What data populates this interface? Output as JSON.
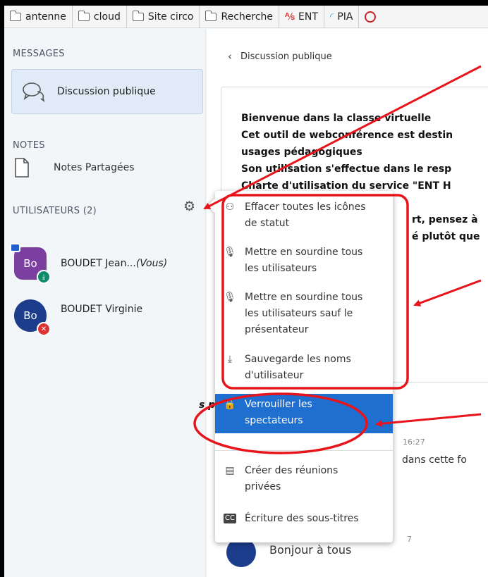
{
  "bookmarks": [
    {
      "label": "antenne",
      "icon": "folder-icon"
    },
    {
      "label": "cloud",
      "icon": "folder-icon"
    },
    {
      "label": "Site circo",
      "icon": "folder-icon"
    },
    {
      "label": "Recherche",
      "icon": "folder-icon"
    },
    {
      "label": "ENT",
      "icon": "ent-logo-icon"
    },
    {
      "label": "PIA",
      "icon": "pia-logo-icon"
    }
  ],
  "sidebar": {
    "messages_header": "MESSAGES",
    "public_chat": "Discussion publique",
    "notes_header": "NOTES",
    "shared_notes": "Notes Partagées",
    "users_header": "UTILISATEURS (2)",
    "users": [
      {
        "initials": "Bo",
        "name": "BOUDET Jean...",
        "suffix": "(Vous)",
        "color": "#7b3fa0"
      },
      {
        "initials": "Bo",
        "name": "BOUDET Virginie",
        "suffix": "",
        "color": "#1c3c8c"
      }
    ]
  },
  "main": {
    "back_label": "Discussion publique",
    "welcome_lines": [
      "Bienvenue dans la classe virtuelle",
      "Cet outil de webconférence est destin",
      "usages pédagogiques",
      "Son utilisation s'effectue dans le resp",
      "Charte d'utilisation du service \"ENT H",
      "rt, pensez à",
      "é plutôt que"
    ],
    "italic_heading": "s publiques o",
    "time1": "16:27",
    "msg_fragment": "dans cette fo",
    "time2": "7",
    "hello": "Bonjour à tous"
  },
  "menu": {
    "items": [
      {
        "label": "Effacer toutes les icônes de statut",
        "icon": "clear-status-icon",
        "lines": [
          "Effacer toutes les icônes",
          "de statut"
        ]
      },
      {
        "label": "Mettre en sourdine tous les utilisateurs",
        "icon": "mute-icon",
        "lines": [
          "Mettre en sourdine tous",
          "les utilisateurs"
        ]
      },
      {
        "label": "Mettre en sourdine tous les utilisateurs sauf le présentateur",
        "icon": "mute-icon",
        "lines": [
          "Mettre en sourdine tous",
          "les utilisateurs sauf le",
          "présentateur"
        ]
      },
      {
        "label": "Sauvegarde les noms d'utilisateur",
        "icon": "download-icon",
        "lines": [
          "Sauvegarde les noms",
          "d'utilisateur"
        ]
      },
      {
        "label": "Verrouiller les spectateurs",
        "icon": "lock-icon",
        "lines": [
          "Verrouiller les",
          "spectateurs"
        ],
        "selected": true
      },
      {
        "label": "Créer des réunions privées",
        "icon": "breakout-rooms-icon",
        "lines": [
          "Créer des réunions",
          "privées"
        ]
      },
      {
        "label": "Écriture des sous-titres",
        "icon": "closed-captions-icon",
        "lines": [
          "Écriture des sous-titres"
        ]
      }
    ]
  },
  "colors": {
    "accent": "#1e6fd0",
    "annotation": "#e8141c",
    "avatar_purple": "#7b3fa0",
    "avatar_navy": "#1c3c8c"
  }
}
